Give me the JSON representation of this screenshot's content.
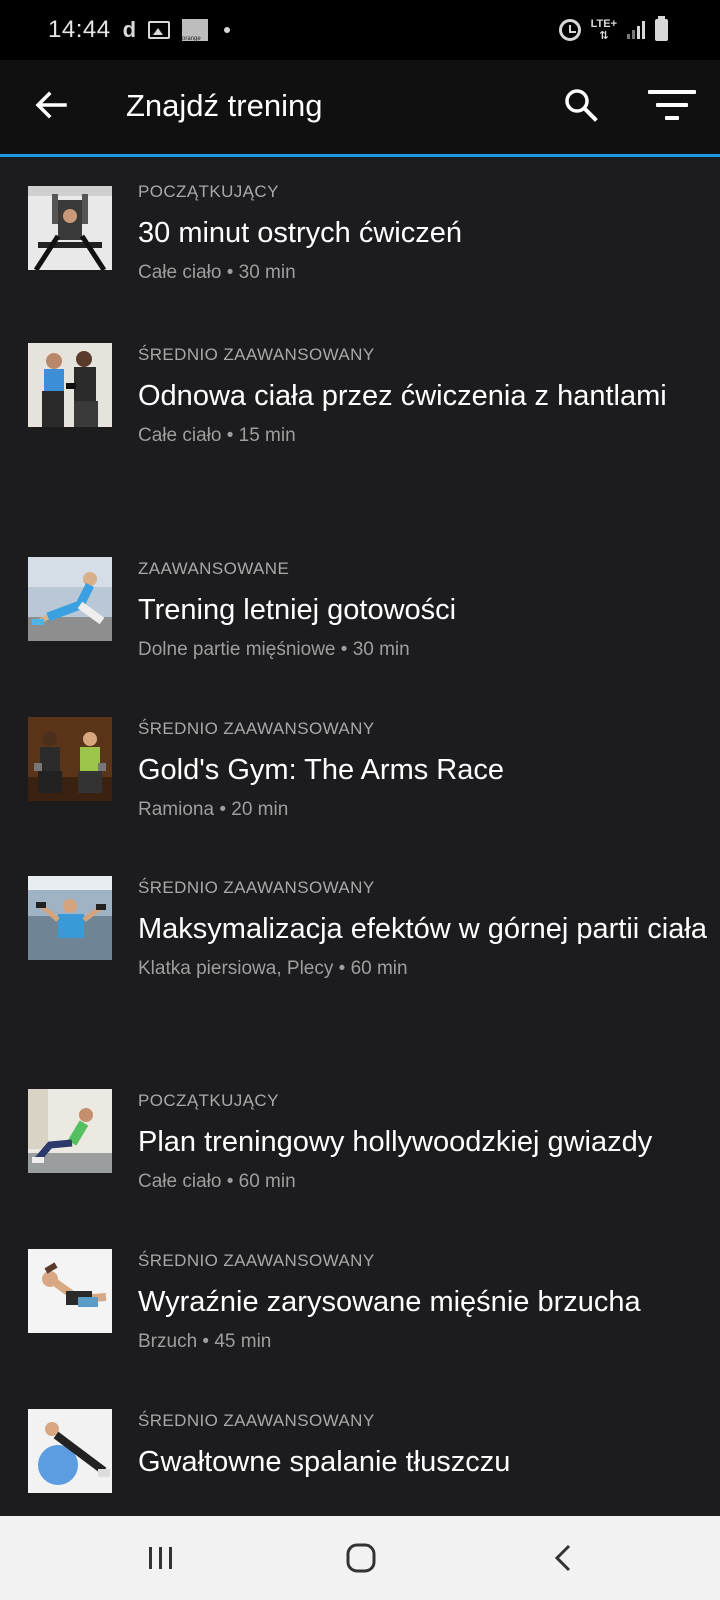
{
  "status_bar": {
    "time": "14:44",
    "carrier_letter": "d",
    "carrier_logo_text": "orange",
    "network": "LTE+"
  },
  "app_bar": {
    "title": "Znajdź trening"
  },
  "workouts": [
    {
      "level": "POCZĄTKUJĄCY",
      "name": "30 minut ostrych ćwiczeń",
      "meta": "Całe ciało • 30 min"
    },
    {
      "level": "ŚREDNIO ZAAWANSOWANY",
      "name": "Odnowa ciała przez ćwiczenia z hantlami",
      "meta": "Całe ciało • 15 min"
    },
    {
      "level": "ZAAWANSOWANE",
      "name": "Trening letniej gotowości",
      "meta": "Dolne partie mięśniowe • 30 min"
    },
    {
      "level": "ŚREDNIO ZAAWANSOWANY",
      "name": "Gold's Gym: The Arms Race",
      "meta": "Ramiona • 20 min"
    },
    {
      "level": "ŚREDNIO ZAAWANSOWANY",
      "name": "Maksymalizacja efektów w górnej partii ciała",
      "meta": "Klatka piersiowa, Plecy • 60 min"
    },
    {
      "level": "POCZĄTKUJĄCY",
      "name": "Plan treningowy hollywoodzkiej gwiazdy",
      "meta": "Całe ciało • 60 min"
    },
    {
      "level": "ŚREDNIO ZAAWANSOWANY",
      "name": "Wyraźnie zarysowane mięśnie brzucha",
      "meta": "Brzuch • 45 min"
    },
    {
      "level": "ŚREDNIO ZAAWANSOWANY",
      "name": "Gwałtowne spalanie tłuszczu",
      "meta": ""
    }
  ],
  "colors": {
    "accent": "#1e9be0",
    "background": "#1c1c1e",
    "app_bar": "#101010"
  }
}
